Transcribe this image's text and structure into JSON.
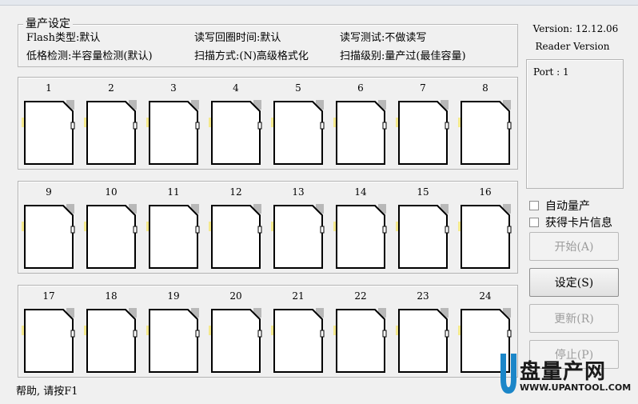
{
  "settings": {
    "title": "量产设定",
    "items": [
      {
        "label": "Flash类型:",
        "value": "默认"
      },
      {
        "label": "读写回圈时间:",
        "value": "默认"
      },
      {
        "label": "读写测试:",
        "value": "不做读写"
      },
      {
        "label": "低格检测:",
        "value": "半容量检测(默认)"
      },
      {
        "label": "扫描方式:",
        "value": "(N)高级格式化"
      },
      {
        "label": "扫描级别:",
        "value": "量产过(最佳容量)"
      }
    ]
  },
  "side": {
    "version": "Version: 12.12.06",
    "reader_version": "Reader Version",
    "port": "Port : 1"
  },
  "options": {
    "auto": "自动量产",
    "card_info": "获得卡片信息"
  },
  "buttons": {
    "start": "开始(A)",
    "settings": "设定(S)",
    "refresh": "更新(R)",
    "stop": "停止(P)"
  },
  "slots": [
    "1",
    "2",
    "3",
    "4",
    "5",
    "6",
    "7",
    "8",
    "9",
    "10",
    "11",
    "12",
    "13",
    "14",
    "15",
    "16",
    "17",
    "18",
    "19",
    "20",
    "21",
    "22",
    "23",
    "24"
  ],
  "status": "帮助, 请按F1",
  "watermark": {
    "logo_letter": "U",
    "brand": "盘量产网",
    "url": "WWW.UPANTOOL.COM"
  },
  "colors": {
    "card_outline": "#000000",
    "card_contact": "#f5e98c",
    "card_tab": "#b8b8b8",
    "logo_blue": "#1b86c8"
  }
}
